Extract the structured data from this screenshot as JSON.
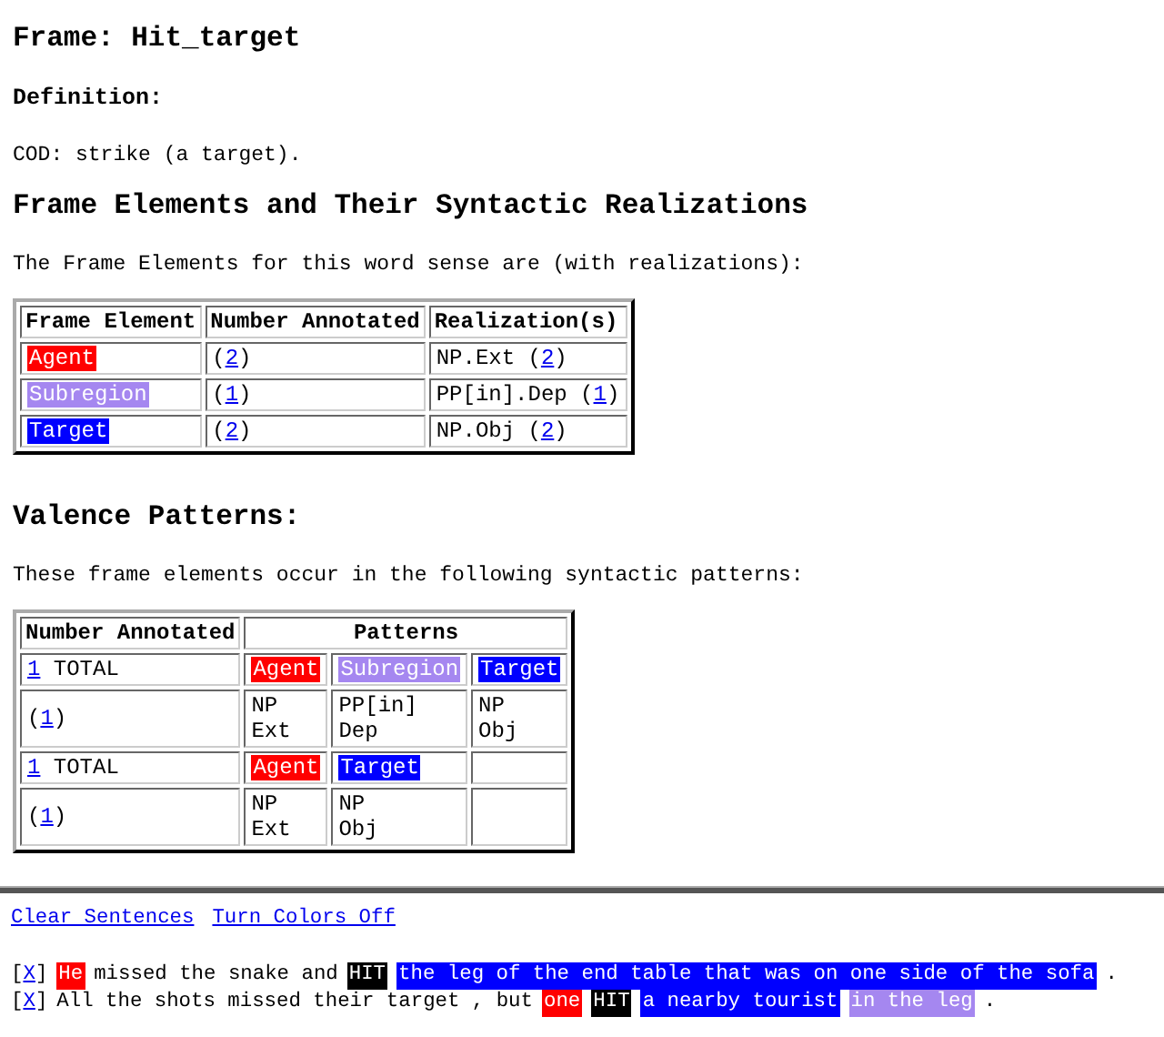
{
  "title": "Frame: Hit_target",
  "definition_heading": "Definition:",
  "definition": "COD: strike (a target).",
  "fe_heading": "Frame Elements and Their Syntactic Realizations",
  "fe_intro": "The Frame Elements for this word sense are (with realizations):",
  "fe_table": {
    "columns": [
      "Frame Element",
      "Number Annotated",
      "Realization(s)"
    ],
    "rows": [
      [
        [
          {
            "kind": "tag",
            "text": "Agent",
            "color": "#ff0000"
          }
        ],
        [
          {
            "kind": "text",
            "text": "("
          },
          {
            "kind": "link",
            "text": "2"
          },
          {
            "kind": "text",
            "text": ")"
          }
        ],
        [
          {
            "kind": "text",
            "text": "NP.Ext ("
          },
          {
            "kind": "link",
            "text": "2"
          },
          {
            "kind": "text",
            "text": ")"
          }
        ]
      ],
      [
        [
          {
            "kind": "tag",
            "text": "Subregion",
            "color": "#a587f0"
          }
        ],
        [
          {
            "kind": "text",
            "text": "("
          },
          {
            "kind": "link",
            "text": "1"
          },
          {
            "kind": "text",
            "text": ")"
          }
        ],
        [
          {
            "kind": "text",
            "text": "PP[in].Dep ("
          },
          {
            "kind": "link",
            "text": "1"
          },
          {
            "kind": "text",
            "text": ")"
          }
        ]
      ],
      [
        [
          {
            "kind": "tag",
            "text": "Target",
            "color": "#0000ff"
          }
        ],
        [
          {
            "kind": "text",
            "text": "("
          },
          {
            "kind": "link",
            "text": "2"
          },
          {
            "kind": "text",
            "text": ")"
          }
        ],
        [
          {
            "kind": "text",
            "text": "NP.Obj ("
          },
          {
            "kind": "link",
            "text": "2"
          },
          {
            "kind": "text",
            "text": ")"
          }
        ]
      ]
    ]
  },
  "valence_heading": "Valence Patterns:",
  "valence_intro": "These frame elements occur in the following syntactic patterns:",
  "valence_table": {
    "columns": [
      "Number Annotated",
      "Patterns"
    ],
    "rows": [
      {
        "number": [
          {
            "kind": "link",
            "text": "1"
          },
          {
            "kind": "text",
            "text": " TOTAL"
          }
        ],
        "patterns": [
          [
            {
              "kind": "tag",
              "text": "Agent",
              "color": "#ff0000"
            }
          ],
          [
            {
              "kind": "tag",
              "text": "Subregion",
              "color": "#a587f0"
            }
          ],
          [
            {
              "kind": "tag",
              "text": "Target",
              "color": "#0000ff"
            }
          ]
        ]
      },
      {
        "number": [
          {
            "kind": "text",
            "text": "("
          },
          {
            "kind": "link",
            "text": "1"
          },
          {
            "kind": "text",
            "text": ")"
          }
        ],
        "patterns": [
          [
            {
              "kind": "text",
              "text": "NP\nExt"
            }
          ],
          [
            {
              "kind": "text",
              "text": "PP[in]\nDep"
            }
          ],
          [
            {
              "kind": "text",
              "text": "NP\nObj"
            }
          ]
        ]
      },
      {
        "number": [
          {
            "kind": "link",
            "text": "1"
          },
          {
            "kind": "text",
            "text": " TOTAL"
          }
        ],
        "patterns": [
          [
            {
              "kind": "tag",
              "text": "Agent",
              "color": "#ff0000"
            }
          ],
          [
            {
              "kind": "tag",
              "text": "Target",
              "color": "#0000ff"
            }
          ]
        ]
      },
      {
        "number": [
          {
            "kind": "text",
            "text": "("
          },
          {
            "kind": "link",
            "text": "1"
          },
          {
            "kind": "text",
            "text": ")"
          }
        ],
        "patterns": [
          [
            {
              "kind": "text",
              "text": "NP\nExt"
            }
          ],
          [
            {
              "kind": "text",
              "text": "NP\nObj"
            }
          ]
        ]
      }
    ]
  },
  "links": [
    "Clear Sentences",
    "Turn Colors Off"
  ],
  "sentences": [
    [
      {
        "kind": "text",
        "text": "["
      },
      {
        "kind": "link",
        "text": "X"
      },
      {
        "kind": "text",
        "text": "]"
      },
      {
        "kind": "tag",
        "text": "He",
        "color": "#ff0000"
      },
      {
        "kind": "text",
        "text": "missed the snake and"
      },
      {
        "kind": "tag",
        "text": "HIT",
        "color": "#000000"
      },
      {
        "kind": "tag",
        "text": "the leg of the end table that was on one side of the sofa",
        "color": "#0000ff"
      },
      {
        "kind": "text",
        "text": "."
      }
    ],
    [
      {
        "kind": "text",
        "text": "["
      },
      {
        "kind": "link",
        "text": "X"
      },
      {
        "kind": "text",
        "text": "]"
      },
      {
        "kind": "text",
        "text": "All the shots missed their target , but"
      },
      {
        "kind": "tag",
        "text": "one",
        "color": "#ff0000"
      },
      {
        "kind": "tag",
        "text": "HIT",
        "color": "#000000"
      },
      {
        "kind": "tag",
        "text": "a nearby tourist",
        "color": "#0000ff"
      },
      {
        "kind": "tag",
        "text": "in the leg",
        "color": "#a587f0"
      },
      {
        "kind": "text",
        "text": "."
      }
    ]
  ]
}
